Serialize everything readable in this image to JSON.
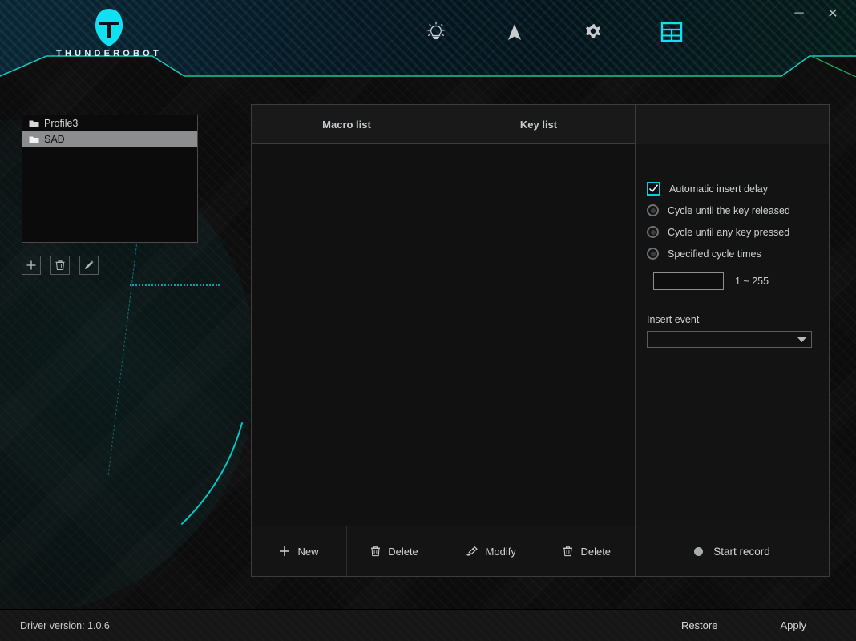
{
  "app": {
    "brand": "THUNDEROBOT",
    "logo_icon": "thunderobot-helmet-logo",
    "accent_cyan": "#10d8e8",
    "accent_green": "#19b36b"
  },
  "titlebar": {
    "minimize_icon": "minimize-icon",
    "minimize_glyph": "─",
    "close_icon": "close-icon",
    "close_glyph": "✕"
  },
  "nav": {
    "items": [
      {
        "icon": "lightbulb-icon",
        "label": "Lighting",
        "active": false
      },
      {
        "icon": "cursor-arrow-icon",
        "label": "Performance",
        "active": false
      },
      {
        "icon": "gear-icon",
        "label": "Settings",
        "active": false
      },
      {
        "icon": "macro-grid-icon",
        "label": "Macro",
        "active": true
      }
    ]
  },
  "profiles": {
    "items": [
      {
        "name": "Profile3",
        "icon": "folder-icon",
        "selected": false
      },
      {
        "name": "SAD",
        "icon": "folder-icon",
        "selected": true
      }
    ],
    "tools": [
      {
        "icon": "plus-icon",
        "label": "Add profile"
      },
      {
        "icon": "trash-icon",
        "label": "Delete profile"
      },
      {
        "icon": "pencil-icon",
        "label": "Rename profile"
      }
    ]
  },
  "panel": {
    "macro_column_header": "Macro list",
    "key_column_header": "Key list",
    "macro_items": [],
    "key_items": [],
    "footer": {
      "macro_new": "New",
      "macro_new_icon": "plus-icon",
      "macro_delete": "Delete",
      "macro_delete_icon": "trash-icon",
      "key_modify": "Modify",
      "key_modify_icon": "brush-edit-icon",
      "key_delete": "Delete",
      "key_delete_icon": "trash-icon",
      "start_record": "Start record",
      "start_record_icon": "record-dot-icon"
    }
  },
  "options": {
    "automatic_insert_delay": {
      "label": "Automatic insert delay",
      "checked": true,
      "check_glyph": "✓"
    },
    "cycle_modes": [
      {
        "label": "Cycle until the key released",
        "selected": false
      },
      {
        "label": "Cycle until any key pressed",
        "selected": false
      },
      {
        "label": "Specified cycle times",
        "selected": false
      }
    ],
    "cycle_times_input": {
      "value": "",
      "placeholder": ""
    },
    "cycle_times_range": "1 ~ 255",
    "insert_event": {
      "label": "Insert event",
      "selected_value": "",
      "dropdown_icon": "chevron-down-icon"
    }
  },
  "footer": {
    "driver_version": "Driver version: 1.0.6",
    "restore": "Restore",
    "apply": "Apply"
  }
}
